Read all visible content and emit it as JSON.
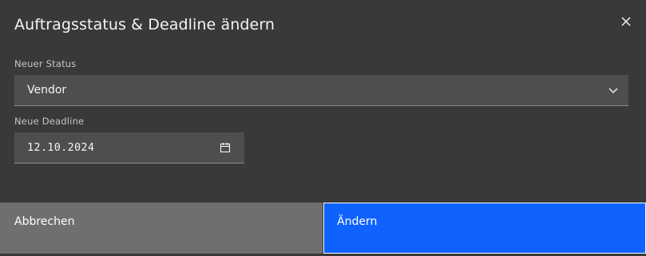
{
  "dialog": {
    "title": "Auftragsstatus & Deadline ändern",
    "close_icon": "close-icon"
  },
  "status_field": {
    "label": "Neuer Status",
    "value": "Vendor",
    "icon": "chevron-down-icon"
  },
  "deadline_field": {
    "label": "Neue Deadline",
    "value": "12.10.2024",
    "icon": "calendar-icon"
  },
  "footer": {
    "cancel_label": "Abbrechen",
    "confirm_label": "Ändern"
  },
  "colors": {
    "modal_bg": "#393939",
    "field_bg": "#4e4e4e",
    "secondary_button": "#6f6f6f",
    "primary_button": "#0f62fe",
    "text": "#f4f4f4"
  }
}
